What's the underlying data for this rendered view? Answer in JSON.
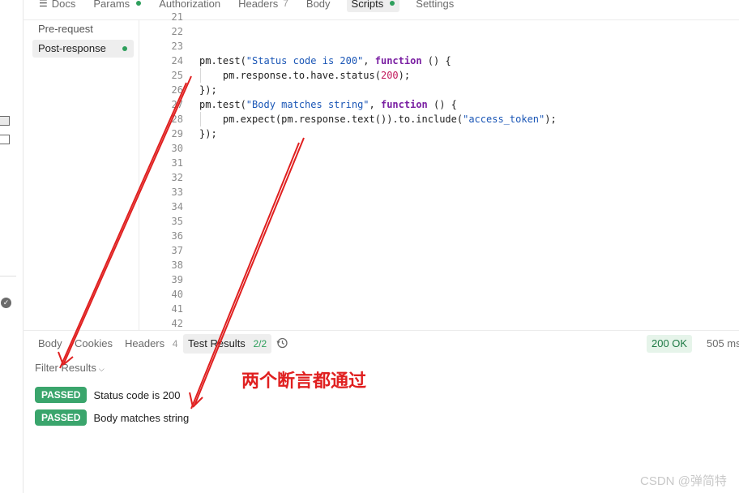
{
  "request_tabs": [
    {
      "label": "Docs",
      "icon": "docs-icon"
    },
    {
      "label": "Params",
      "dot": true
    },
    {
      "label": "Authorization"
    },
    {
      "label": "Headers",
      "count": "7"
    },
    {
      "label": "Body"
    },
    {
      "label": "Scripts",
      "dot": true,
      "active": true
    },
    {
      "label": "Settings"
    }
  ],
  "scripts_nav": {
    "pre_request": "Pre-request",
    "post_response": "Post-response"
  },
  "editor": {
    "line_numbers": [
      "21",
      "22",
      "23",
      "24",
      "25",
      "26",
      "27",
      "28",
      "29",
      "30",
      "31",
      "32",
      "33",
      "34",
      "35",
      "36",
      "37",
      "38",
      "39",
      "40",
      "41",
      "42"
    ],
    "code_lines": [
      "",
      "",
      "",
      "pm.test(\"Status code is 200\", function () {",
      "    pm.response.to.have.status(200);",
      "});",
      "pm.test(\"Body matches string\", function () {",
      "    pm.expect(pm.response.text()).to.include(\"access_token\");",
      "});",
      "",
      "",
      "",
      "",
      "",
      "",
      "",
      "",
      "",
      "",
      "",
      "",
      ""
    ]
  },
  "response_tabs": {
    "body": "Body",
    "cookies": "Cookies",
    "headers": "Headers",
    "headers_count": "4",
    "test_results": "Test Results",
    "test_results_count": "2/2"
  },
  "status": "200 OK",
  "response_size": "505 ms",
  "filter_label": "Filter Results",
  "results": [
    {
      "status": "PASSED",
      "name": "Status code is 200"
    },
    {
      "status": "PASSED",
      "name": "Body matches string"
    }
  ],
  "annotation": "两个断言都通过",
  "watermark": "CSDN @弹简特",
  "colors": {
    "passed": "#3aa56c",
    "dot_green": "#2e9f5c",
    "annotation_red": "#e02020"
  }
}
